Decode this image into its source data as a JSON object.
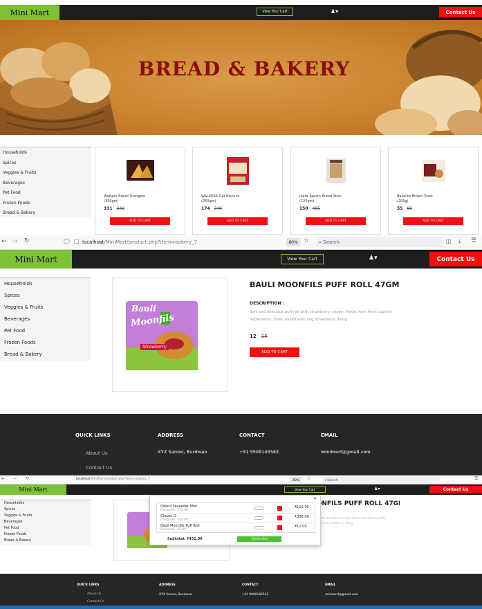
{
  "colors": {
    "accent": "#7dc137",
    "danger": "#f10f0f",
    "dark": "#1e1e1e"
  },
  "header": {
    "logo": "Mini Mart",
    "view_cart": "View Your Cart",
    "contact": "Contact Us",
    "user_icon": "user-icon"
  },
  "banner": {
    "title": "BREAD & BAKERY"
  },
  "categories": [
    "Households",
    "Spices",
    "Veggies & Fruits",
    "Beverages",
    "Pet Food",
    "Frozen Foods",
    "Bread & Bakery"
  ],
  "products": [
    {
      "name": "Walkers Bread Triangles",
      "size": "(150gm)",
      "price": "331",
      "mrp": "349",
      "button": "ADD TO CART"
    },
    {
      "name": "WALKERS Oat Biscuits",
      "size": "(250gm)",
      "price": "174",
      "mrp": "349",
      "button": "ADD TO CART"
    },
    {
      "name": "Jeera Ajwain Bread Stick",
      "size": "(125gm)",
      "price": "150",
      "mrp": "495",
      "button": "ADD TO CART"
    },
    {
      "name": "Bakelite Brown Toast",
      "size": "(200g)",
      "price": "55",
      "mrp": "60",
      "button": "ADD TO CART"
    }
  ],
  "browser": {
    "url_host": "localhost",
    "url_path": "/MiniMart/product.php?item=bakery_7",
    "zoom": "80%",
    "search": "Search"
  },
  "product": {
    "title": "BAULI MOONFILS PUFF ROLL 47GM",
    "desc_label": "DESCRIPTION :",
    "desc": "Soft and delicious puff roll with strawberry cream. Made from finest quality ingredients. Oven baked with veg strawberry filling",
    "price": "12",
    "mrp": "15",
    "button": "ADD TO CART",
    "pack_brand": "Bauli",
    "pack_name": "Moonfils",
    "pack_flavor": "Strawberry"
  },
  "footer": {
    "quick_links": "QUICK LINKS",
    "about": "About Us",
    "contact": "Contact Us",
    "address_h": "ADDRESS",
    "address": "XYZ Saroni, Burdwan",
    "contact_h": "CONTACT",
    "phone": "+91 9908145563",
    "email_h": "EMAIL",
    "email": "minimart@gmail.com"
  },
  "cart": {
    "items": [
      {
        "name": "Odonil Lavender Mist",
        "discount": "Discount : ₹15.00",
        "price": "₹110.00"
      },
      {
        "name": "Glucon D",
        "discount": "Discount : ₹43.00",
        "price": "₹308.00"
      },
      {
        "name": "Bauli Moonfils Puff Roll",
        "discount": "Discount : ₹3.00",
        "price": "₹12.00"
      }
    ],
    "subtotal": "Subtotal: ₹431.00",
    "checkout": "Check Out",
    "close": "×"
  }
}
